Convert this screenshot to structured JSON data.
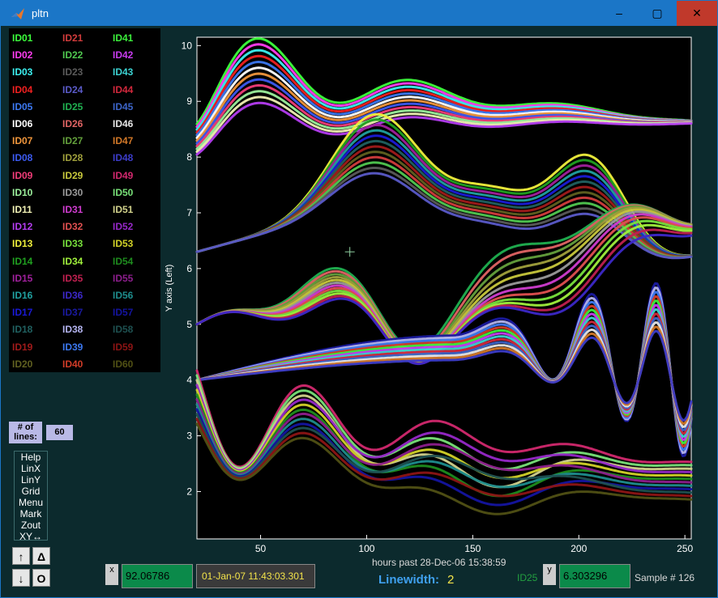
{
  "window": {
    "title": "pltn",
    "minimize_label": "–",
    "maximize_label": "▢",
    "close_label": "✕"
  },
  "legend": {
    "columns": [
      [
        {
          "id": "ID01",
          "color": "#3cff3c"
        },
        {
          "id": "ID02",
          "color": "#ff3cf0"
        },
        {
          "id": "ID03",
          "color": "#3cf0f0"
        },
        {
          "id": "ID04",
          "color": "#f02020"
        },
        {
          "id": "ID05",
          "color": "#3c78f0"
        },
        {
          "id": "ID06",
          "color": "#ffffff"
        },
        {
          "id": "ID07",
          "color": "#f0963c"
        },
        {
          "id": "ID08",
          "color": "#3c5af0"
        },
        {
          "id": "ID09",
          "color": "#f03c78"
        },
        {
          "id": "ID10",
          "color": "#9cf09c"
        },
        {
          "id": "ID11",
          "color": "#f0f0b4"
        },
        {
          "id": "ID12",
          "color": "#b43cf0"
        },
        {
          "id": "ID13",
          "color": "#f0f03c"
        },
        {
          "id": "ID14",
          "color": "#20a020"
        },
        {
          "id": "ID15",
          "color": "#a0209c"
        },
        {
          "id": "ID16",
          "color": "#20a0a0"
        },
        {
          "id": "ID17",
          "color": "#1a1ad6"
        },
        {
          "id": "ID18",
          "color": "#206060"
        },
        {
          "id": "ID19",
          "color": "#a01a1a"
        },
        {
          "id": "ID20",
          "color": "#606020"
        }
      ],
      [
        {
          "id": "ID21",
          "color": "#d23c3c"
        },
        {
          "id": "ID22",
          "color": "#50c850"
        },
        {
          "id": "ID23",
          "color": "#5a5a5a"
        },
        {
          "id": "ID24",
          "color": "#5a5ac8"
        },
        {
          "id": "ID25",
          "color": "#20b050"
        },
        {
          "id": "ID26",
          "color": "#e06464"
        },
        {
          "id": "ID27",
          "color": "#64a03c"
        },
        {
          "id": "ID28",
          "color": "#a0a03c"
        },
        {
          "id": "ID29",
          "color": "#c8c83c"
        },
        {
          "id": "ID30",
          "color": "#9a9a9a"
        },
        {
          "id": "ID31",
          "color": "#d03cd0"
        },
        {
          "id": "ID32",
          "color": "#e05050"
        },
        {
          "id": "ID33",
          "color": "#78e03c"
        },
        {
          "id": "ID34",
          "color": "#a0f03c"
        },
        {
          "id": "ID35",
          "color": "#c02050"
        },
        {
          "id": "ID36",
          "color": "#3c28c8"
        },
        {
          "id": "ID37",
          "color": "#1a1aa0"
        },
        {
          "id": "ID38",
          "color": "#b4b4f0"
        },
        {
          "id": "ID39",
          "color": "#3c78f0"
        },
        {
          "id": "ID40",
          "color": "#d23c28"
        }
      ],
      [
        {
          "id": "ID41",
          "color": "#3cf03c"
        },
        {
          "id": "ID42",
          "color": "#c83cf0"
        },
        {
          "id": "ID43",
          "color": "#3cd2d2"
        },
        {
          "id": "ID44",
          "color": "#d2283c"
        },
        {
          "id": "ID45",
          "color": "#3c64c8"
        },
        {
          "id": "ID46",
          "color": "#e6e6e6"
        },
        {
          "id": "ID47",
          "color": "#d27828"
        },
        {
          "id": "ID48",
          "color": "#3c3cc8"
        },
        {
          "id": "ID49",
          "color": "#d2286e"
        },
        {
          "id": "ID50",
          "color": "#78e078"
        },
        {
          "id": "ID51",
          "color": "#d2d28c"
        },
        {
          "id": "ID52",
          "color": "#9628c8"
        },
        {
          "id": "ID53",
          "color": "#d2d228"
        },
        {
          "id": "ID54",
          "color": "#1e8c1e"
        },
        {
          "id": "ID55",
          "color": "#8c1e8c"
        },
        {
          "id": "ID56",
          "color": "#1e8c8c"
        },
        {
          "id": "ID57",
          "color": "#1414a0"
        },
        {
          "id": "ID58",
          "color": "#1e5050"
        },
        {
          "id": "ID59",
          "color": "#8c1414"
        },
        {
          "id": "ID60",
          "color": "#505014"
        }
      ]
    ]
  },
  "controls": {
    "nlines_label": "# of lines:",
    "nlines_value": "60",
    "menu_items": [
      "Help",
      "LinX",
      "LinY",
      "Grid",
      "Menu",
      "Mark",
      "Zout",
      "XY↔"
    ],
    "btn_up": "↑",
    "btn_delta": "Δ",
    "btn_down": "↓",
    "btn_o": "O"
  },
  "readouts": {
    "x_label": "x",
    "x_value": "92.06786",
    "date_value": "01-Jan-07 11:43:03.301",
    "y_label": "y",
    "y_value": "6.303296",
    "linewidth_label": "Linewidth:",
    "linewidth_value": "2",
    "selected_id": "ID25",
    "sample_text": "Sample  # 126"
  },
  "chart_data": {
    "type": "line",
    "xlabel": "hours past 28-Dec-06 15:38:59",
    "ylabel": "Y axis (Left)",
    "xlim": [
      20,
      253
    ],
    "ylim": [
      1.15,
      10.15
    ],
    "xticks": [
      50,
      100,
      150,
      200,
      250
    ],
    "yticks": [
      2,
      3,
      4,
      5,
      6,
      7,
      8,
      9,
      10
    ],
    "series_count": 60,
    "groups": [
      {
        "ids": "ID01–ID12",
        "start": 8.6,
        "end": 8.6,
        "desc": "damped oscillation, peaks near 10"
      },
      {
        "ids": "ID13–ID24",
        "start": 6.3,
        "end": 6.3,
        "desc": "broad humps near 8.5"
      },
      {
        "ids": "ID25–ID36",
        "start": 5.0,
        "end": 7.0,
        "desc": "rising wave"
      },
      {
        "ids": "ID37–ID48",
        "start": 4.0,
        "end": 4.5,
        "desc": "growing oscillation peaking near 5.8"
      },
      {
        "ids": "ID49–ID60",
        "start": 3.2,
        "end": 2.2,
        "desc": "damped oscillation, minimum near 1.4"
      }
    ],
    "cursor_mark": {
      "x": 92.07,
      "y": 6.3
    }
  }
}
